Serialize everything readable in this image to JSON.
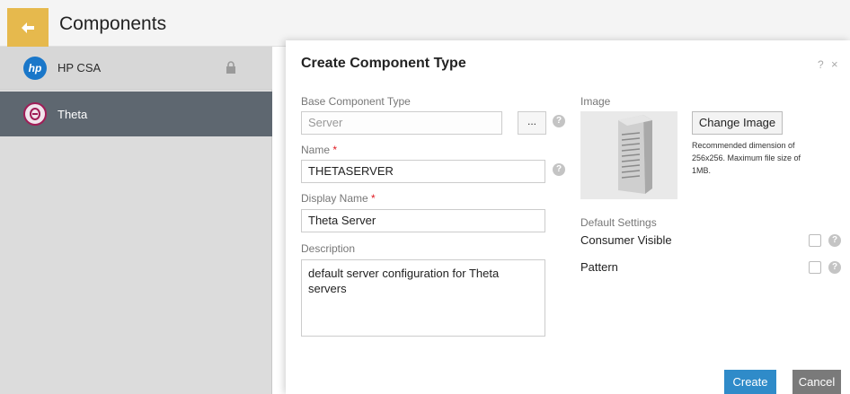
{
  "header": {
    "title": "Components"
  },
  "sidebar": {
    "items": [
      {
        "label": "HP CSA",
        "icon": "hp-logo-icon",
        "locked": true
      },
      {
        "label": "Theta",
        "icon": "theta-logo-icon",
        "selected": true
      }
    ]
  },
  "dialog": {
    "title": "Create Component Type",
    "help": "?",
    "close": "×",
    "base_component_type": {
      "label": "Base Component Type",
      "value": "Server",
      "browse": "..."
    },
    "name": {
      "label": "Name",
      "required": "*",
      "value": "THETASERVER"
    },
    "display_name": {
      "label": "Display Name",
      "required": "*",
      "value": "Theta Server"
    },
    "description": {
      "label": "Description",
      "value": "default server configuration for Theta servers"
    },
    "image": {
      "label": "Image",
      "change_button": "Change Image",
      "note": "Recommended dimension of 256x256. Maximum file size of 1MB."
    },
    "default_settings": {
      "label": "Default Settings",
      "consumer_visible": "Consumer Visible",
      "pattern": "Pattern"
    },
    "create_button": "Create",
    "cancel_button": "Cancel"
  },
  "colors": {
    "accent": "#e6b94d",
    "primary": "#2f8bc9",
    "selected_row": "#5e6770"
  }
}
